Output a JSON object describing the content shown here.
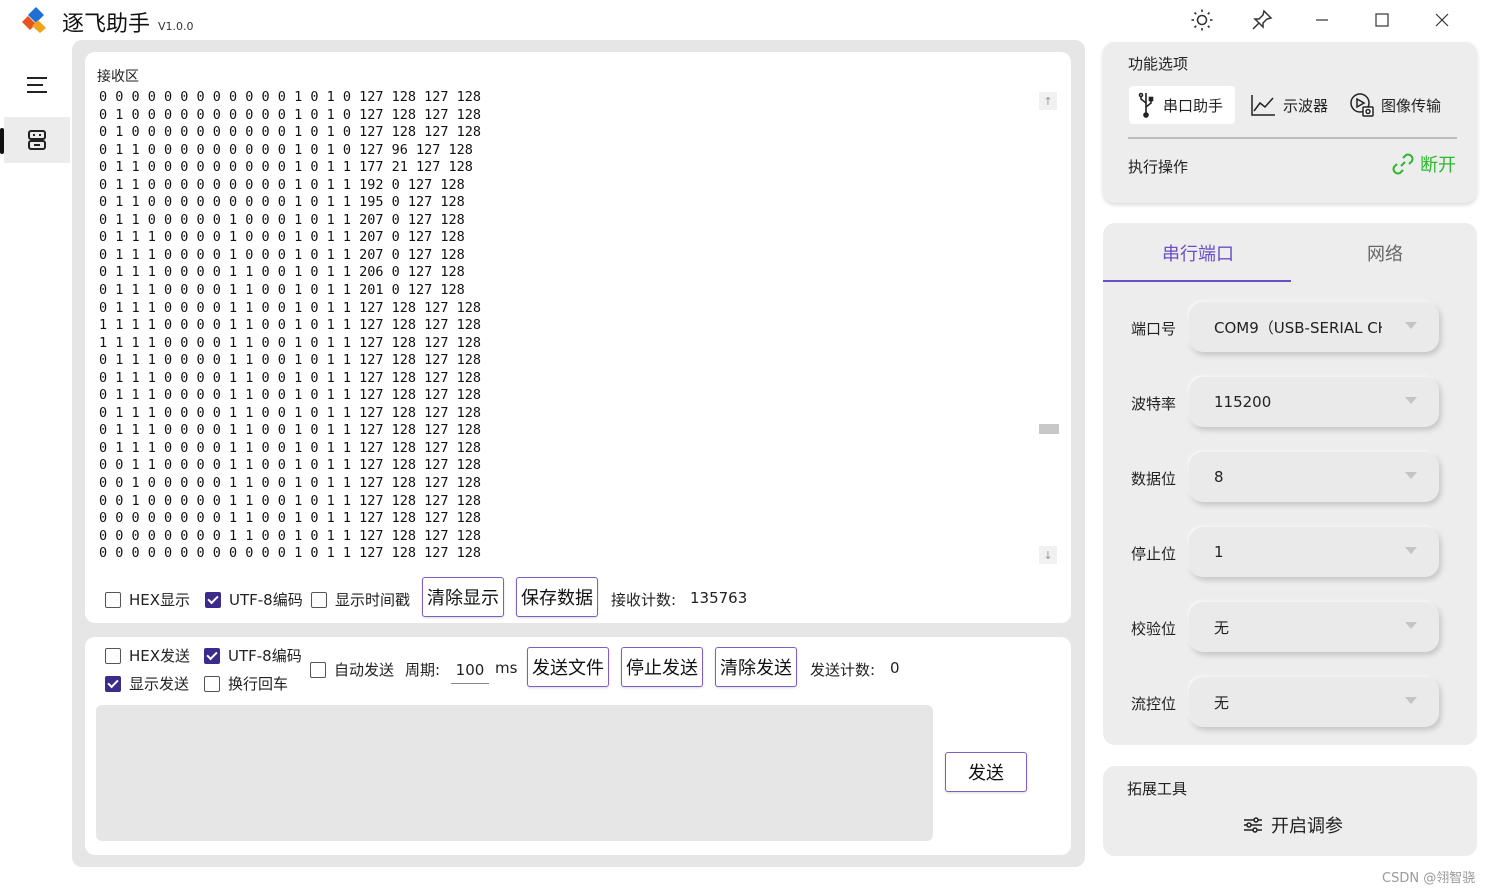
{
  "window": {
    "title": "逐飞助手",
    "version": "V1.0.0"
  },
  "colors": {
    "accent": "#6b4fc4",
    "checkbox": "#3b2b8a",
    "connected": "#2db82d",
    "panel_bg": "#e6e6e6"
  },
  "rail": {
    "items": [
      {
        "icon": "menu-icon"
      },
      {
        "icon": "robot-icon"
      }
    ]
  },
  "receive": {
    "label": "接收区",
    "lines": [
      "0 0 0 0 0 0 0 0 0 0 0 0 1 0 1 0 127 128 127 128",
      "0 1 0 0 0 0 0 0 0 0 0 0 1 0 1 0 127 128 127 128",
      "0 1 0 0 0 0 0 0 0 0 0 0 1 0 1 0 127 128 127 128",
      "0 1 1 0 0 0 0 0 0 0 0 0 1 0 1 0 127 96 127 128",
      "0 1 1 0 0 0 0 0 0 0 0 0 1 0 1 1 177 21 127 128",
      "0 1 1 0 0 0 0 0 0 0 0 0 1 0 1 1 192 0 127 128",
      "0 1 1 0 0 0 0 0 0 0 0 0 1 0 1 1 195 0 127 128",
      "0 1 1 0 0 0 0 0 1 0 0 0 1 0 1 1 207 0 127 128",
      "0 1 1 1 0 0 0 0 1 0 0 0 1 0 1 1 207 0 127 128",
      "0 1 1 1 0 0 0 0 1 0 0 0 1 0 1 1 207 0 127 128",
      "0 1 1 1 0 0 0 0 1 1 0 0 1 0 1 1 206 0 127 128",
      "0 1 1 1 0 0 0 0 1 1 0 0 1 0 1 1 201 0 127 128",
      "0 1 1 1 0 0 0 0 1 1 0 0 1 0 1 1 127 128 127 128",
      "1 1 1 1 0 0 0 0 1 1 0 0 1 0 1 1 127 128 127 128",
      "1 1 1 1 0 0 0 0 1 1 0 0 1 0 1 1 127 128 127 128",
      "0 1 1 1 0 0 0 0 1 1 0 0 1 0 1 1 127 128 127 128",
      "0 1 1 1 0 0 0 0 1 1 0 0 1 0 1 1 127 128 127 128",
      "0 1 1 1 0 0 0 0 1 1 0 0 1 0 1 1 127 128 127 128",
      "0 1 1 1 0 0 0 0 1 1 0 0 1 0 1 1 127 128 127 128",
      "0 1 1 1 0 0 0 0 1 1 0 0 1 0 1 1 127 128 127 128",
      "0 1 1 1 0 0 0 0 1 1 0 0 1 0 1 1 127 128 127 128",
      "0 0 1 1 0 0 0 0 1 1 0 0 1 0 1 1 127 128 127 128",
      "0 0 1 0 0 0 0 0 1 1 0 0 1 0 1 1 127 128 127 128",
      "0 0 1 0 0 0 0 0 1 1 0 0 1 0 1 1 127 128 127 128",
      "0 0 0 0 0 0 0 0 1 1 0 0 1 0 1 1 127 128 127 128",
      "0 0 0 0 0 0 0 0 1 1 0 0 1 0 1 1 127 128 127 128",
      "0 0 0 0 0 0 0 0 0 0 0 0 1 0 1 1 127 128 127 128"
    ],
    "options": {
      "hex_display": {
        "label": "HEX显示",
        "checked": false
      },
      "utf8": {
        "label": "UTF-8编码",
        "checked": true
      },
      "timestamp": {
        "label": "显示时间戳",
        "checked": false
      }
    },
    "clear_label": "清除显示",
    "save_label": "保存数据",
    "count_label": "接收计数:",
    "count_value": "135763"
  },
  "send": {
    "options": {
      "hex_send": {
        "label": "HEX发送",
        "checked": false
      },
      "utf8": {
        "label": "UTF-8编码",
        "checked": true
      },
      "show_send": {
        "label": "显示发送",
        "checked": true
      },
      "newline": {
        "label": "换行回车",
        "checked": false
      },
      "auto_send": {
        "label": "自动发送",
        "checked": false
      }
    },
    "period_label": "周期:",
    "period_value": "100",
    "period_unit": "ms",
    "send_file_label": "发送文件",
    "stop_send_label": "停止发送",
    "clear_send_label": "清除发送",
    "count_label": "发送计数:",
    "count_value": "0",
    "send_label": "发送"
  },
  "functions": {
    "title": "功能选项",
    "tabs": [
      {
        "label": "串口助手",
        "icon": "usb-icon",
        "active": true
      },
      {
        "label": "示波器",
        "icon": "chart-icon",
        "active": false
      },
      {
        "label": "图像传输",
        "icon": "image-transfer-icon",
        "active": false
      }
    ],
    "action_title": "执行操作",
    "disconnect_label": "断开"
  },
  "serial": {
    "tabs": [
      {
        "label": "串行端口",
        "active": true
      },
      {
        "label": "网络",
        "active": false
      }
    ],
    "fields": [
      {
        "label": "端口号",
        "value": "COM9（USB-SERIAL CH340）"
      },
      {
        "label": "波特率",
        "value": "115200"
      },
      {
        "label": "数据位",
        "value": "8"
      },
      {
        "label": "停止位",
        "value": "1"
      },
      {
        "label": "校验位",
        "value": "无"
      },
      {
        "label": "流控位",
        "value": "无"
      }
    ]
  },
  "tools": {
    "title": "拓展工具",
    "tune_label": "开启调参"
  },
  "watermark": "CSDN @翎智骁"
}
